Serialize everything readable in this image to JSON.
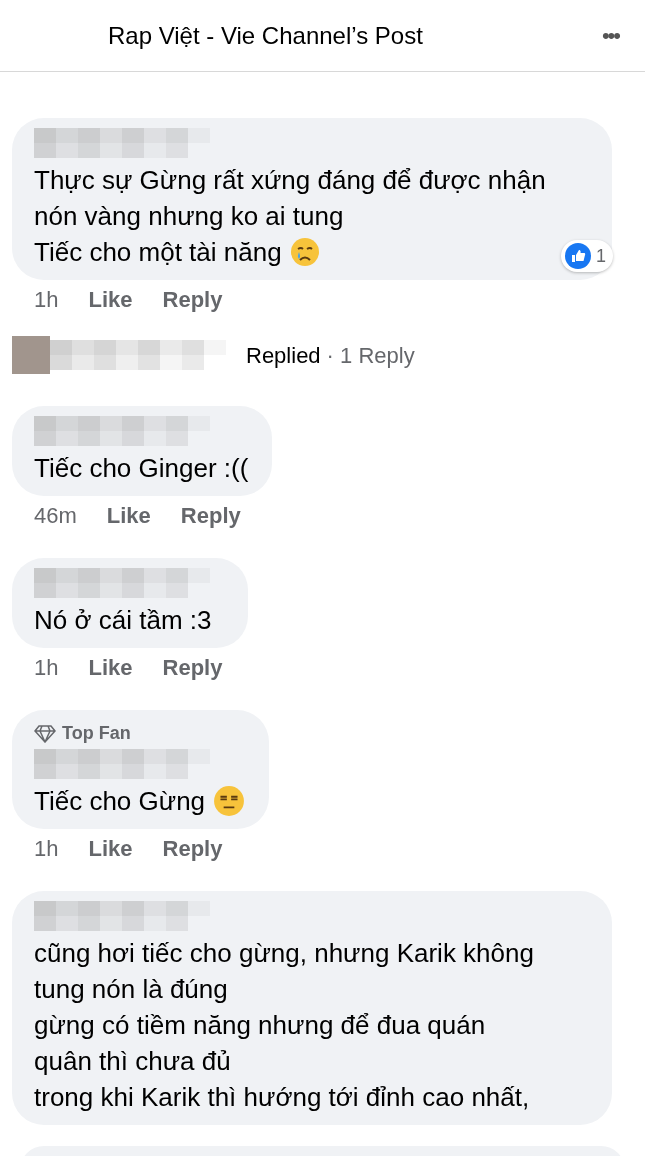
{
  "header": {
    "title": "Rap Việt - Vie Channel’s Post",
    "more": "•••"
  },
  "comments": [
    {
      "kind": "comment",
      "lines": [
        {
          "kind": "plain",
          "text": "Thực sự Gừng rất xứng đáng để được nhận"
        },
        {
          "kind": "plain",
          "text": "nón vàng nhưng ko ai tung"
        },
        {
          "kind": "crying",
          "text": "Tiếc cho một tài năng"
        }
      ],
      "time": "1h",
      "like": "Like",
      "reply": "Reply",
      "reactions": "1",
      "wide": true
    },
    {
      "kind": "replied",
      "label": "Replied",
      "count": "· 1 Reply"
    },
    {
      "kind": "comment",
      "lines": [
        {
          "kind": "plain",
          "text": "Tiếc cho Ginger :(("
        }
      ],
      "time": "46m",
      "like": "Like",
      "reply": "Reply",
      "wide": false
    },
    {
      "kind": "comment",
      "lines": [
        {
          "kind": "plain",
          "text": "Nó ở cái tầm :3"
        }
      ],
      "time": "1h",
      "like": "Like",
      "reply": "Reply",
      "wide": false
    },
    {
      "kind": "comment",
      "top_fan": "Top Fan",
      "lines": [
        {
          "kind": "expressionless",
          "text": "Tiếc cho Gừng"
        }
      ],
      "time": "1h",
      "like": "Like",
      "reply": "Reply",
      "wide": false
    },
    {
      "kind": "comment",
      "lines": [
        {
          "kind": "plain",
          "text": "cũng hơi tiếc cho gừng, nhưng Karik không"
        },
        {
          "kind": "plain",
          "text": "tung nón là đúng"
        },
        {
          "kind": "plain",
          "text": "gừng có tiềm năng nhưng để đua quán"
        },
        {
          "kind": "plain",
          "text": "quân thì chưa đủ"
        },
        {
          "kind": "plain",
          "text": "trong khi Karik thì hướng tới đỉnh cao nhất,"
        }
      ],
      "wide": true
    }
  ]
}
